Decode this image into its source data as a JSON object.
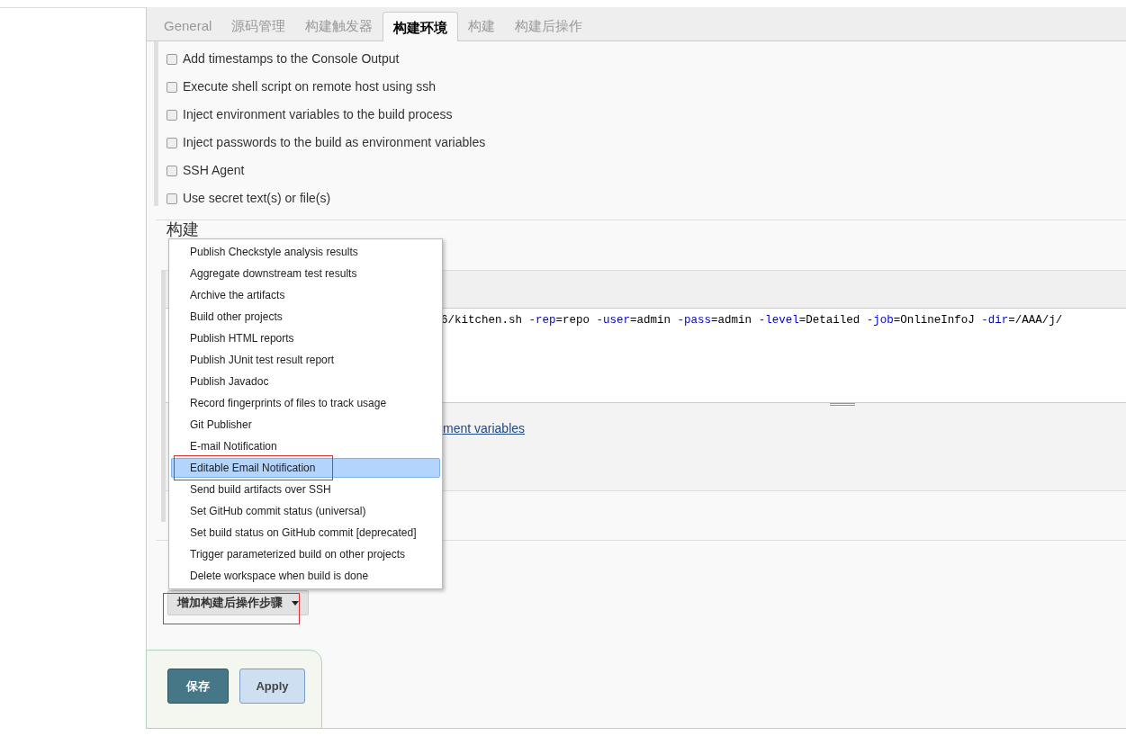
{
  "tabs": [
    {
      "label": "General",
      "selected": false
    },
    {
      "label": "源码管理",
      "selected": false
    },
    {
      "label": "构建触发器",
      "selected": false
    },
    {
      "label": "构建环境",
      "selected": true
    },
    {
      "label": "构建",
      "selected": false
    },
    {
      "label": "构建后操作",
      "selected": false
    }
  ],
  "build_environment": [
    {
      "label": "Add timestamps to the Console Output",
      "checked": false
    },
    {
      "label": "Execute shell script on remote host using ssh",
      "checked": false
    },
    {
      "label": "Inject environment variables to the build process",
      "checked": false
    },
    {
      "label": "Inject passwords to the build as environment variables",
      "checked": false
    },
    {
      "label": "SSH Agent",
      "checked": false
    },
    {
      "label": "Use secret text(s) or file(s)",
      "checked": false
    }
  ],
  "build_heading": "构建",
  "command": [
    {
      "text": "6/kitchen.sh ",
      "kind": "plain"
    },
    {
      "text": "-rep",
      "kind": "flag"
    },
    {
      "text": "=repo ",
      "kind": "plain"
    },
    {
      "text": "-user",
      "kind": "flag"
    },
    {
      "text": "=admin ",
      "kind": "plain"
    },
    {
      "text": "-pass",
      "kind": "flag"
    },
    {
      "text": "=admin ",
      "kind": "plain"
    },
    {
      "text": "-level",
      "kind": "flag"
    },
    {
      "text": "=Detailed ",
      "kind": "plain"
    },
    {
      "text": "-job",
      "kind": "flag"
    },
    {
      "text": "=OnlineInfoJ ",
      "kind": "plain"
    },
    {
      "text": "-dir",
      "kind": "flag"
    },
    {
      "text": "=/AAA/j/",
      "kind": "plain"
    }
  ],
  "env_link": "ment variables",
  "menu": [
    {
      "label": "Publish Checkstyle analysis results",
      "selected": false,
      "annotated": false
    },
    {
      "label": "Aggregate downstream test results",
      "selected": false,
      "annotated": false
    },
    {
      "label": "Archive the artifacts",
      "selected": false,
      "annotated": false
    },
    {
      "label": "Build other projects",
      "selected": false,
      "annotated": false
    },
    {
      "label": "Publish HTML reports",
      "selected": false,
      "annotated": false
    },
    {
      "label": "Publish JUnit test result report",
      "selected": false,
      "annotated": false
    },
    {
      "label": "Publish Javadoc",
      "selected": false,
      "annotated": false
    },
    {
      "label": "Record fingerprints of files to track usage",
      "selected": false,
      "annotated": false
    },
    {
      "label": "Git Publisher",
      "selected": false,
      "annotated": false
    },
    {
      "label": "E-mail Notification",
      "selected": false,
      "annotated": false
    },
    {
      "label": "Editable Email Notification",
      "selected": true,
      "annotated": true
    },
    {
      "label": "Send build artifacts over SSH",
      "selected": false,
      "annotated": false
    },
    {
      "label": "Set GitHub commit status (universal)",
      "selected": false,
      "annotated": false
    },
    {
      "label": "Set build status on GitHub commit [deprecated]",
      "selected": false,
      "annotated": false
    },
    {
      "label": "Trigger parameterized build on other projects",
      "selected": false,
      "annotated": false
    },
    {
      "label": "Delete workspace when build is done",
      "selected": false,
      "annotated": false
    }
  ],
  "add_post_build_button": {
    "label": "增加构建后操作步骤",
    "annotated": true
  },
  "buttons": [
    {
      "label": "保存",
      "kind": "primary"
    },
    {
      "label": "Apply",
      "kind": "secondary"
    }
  ]
}
